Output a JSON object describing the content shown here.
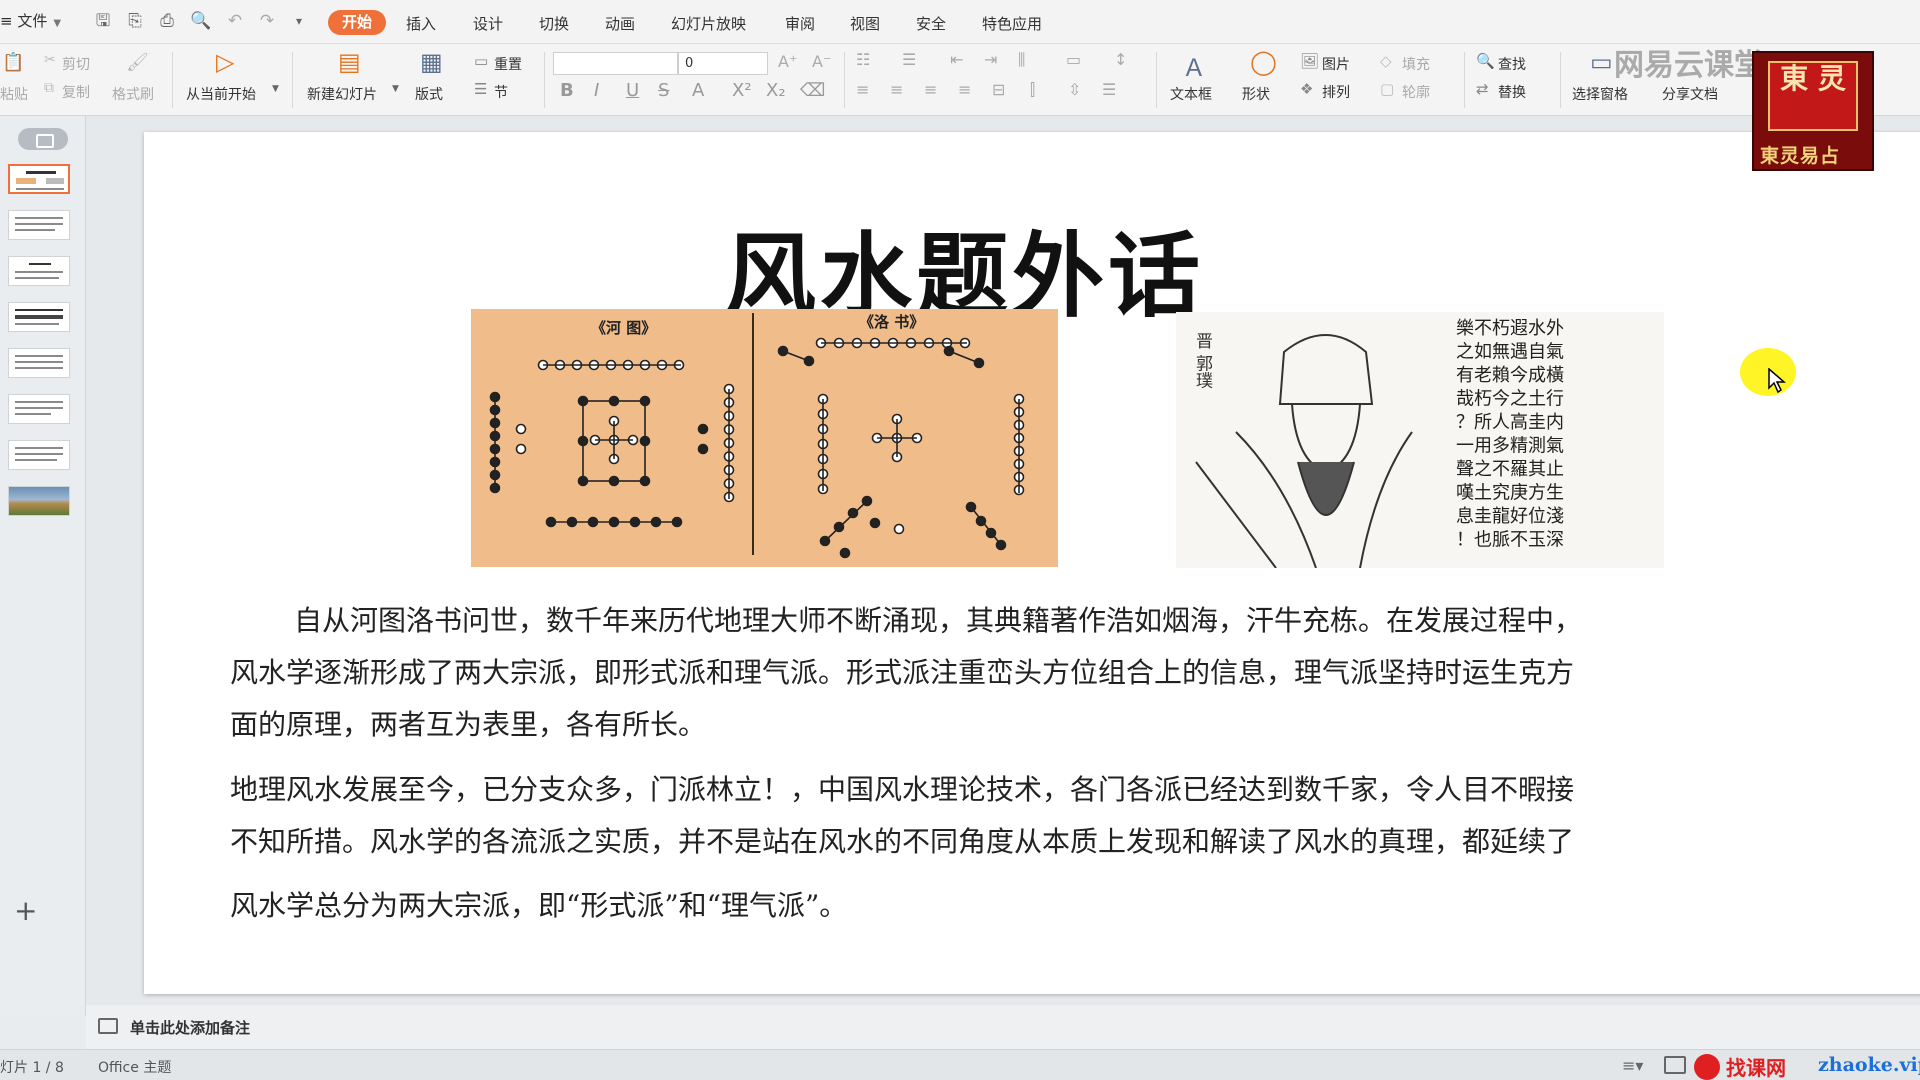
{
  "menubar": {
    "file_label": "文件",
    "tabs": [
      "开始",
      "插入",
      "设计",
      "切换",
      "动画",
      "幻灯片放映",
      "审阅",
      "视图",
      "安全",
      "特色应用"
    ],
    "active_tab": "开始",
    "accent_color": "#f0703a"
  },
  "ribbon": {
    "paste_label": "粘贴",
    "cut_label": "剪切",
    "copy_label": "复制",
    "format_painter_label": "格式刷",
    "play_from_current_label": "从当前开始",
    "new_slide_label": "新建幻灯片",
    "layout_label": "版式",
    "reset_label": "重置",
    "section_label": "节",
    "font_size_value": "0",
    "textbox_label": "文本框",
    "shape_label": "形状",
    "picture_label": "图片",
    "fill_label": "填充",
    "arrange_label": "排列",
    "outline_label": "轮廓",
    "find_label": "查找",
    "replace_label": "替换",
    "selection_pane_label": "选择窗格",
    "share_doc_label": "分享文档"
  },
  "watermark": {
    "cloud_text": "网易云课堂",
    "logo_chars": "東 灵",
    "logo_text": "東灵易占"
  },
  "slide": {
    "title": "风水题外话",
    "hetu_title": "《河 图》",
    "luoshu_title": "《洛 书》",
    "portrait_name": "晋 郭璞",
    "poem_lines": [
      "樂不朽遐水外",
      "之如無遇自氣",
      "有老賴今成橫",
      "哉朽今之土行",
      "？所人高圭内",
      "一用多精測氣",
      "聲之不羅其止",
      "嘆土究庚方生",
      "息圭龍好位淺",
      "！也脈不玉深"
    ],
    "paragraphs": [
      "自从河图洛书问世，数千年来历代地理大师不断涌现，其典籍著作浩如烟海，汗牛充栋。在发展过程中，",
      "风水学逐渐形成了两大宗派，即形式派和理气派。形式派注重峦头方位组合上的信息，理气派坚持时运生克方",
      "面的原理，两者互为表里，各有所长。",
      "地理风水发展至今，已分支众多，门派林立！，中国风水理论技术，各门各派已经达到数千家，令人目不暇接",
      "不知所措。风水学的各流派之实质，并不是站在风水的不同角度从本质上发现和解读了风水的真理，都延续了",
      "风水学总分为两大宗派，即“形式派”和“理气派”。"
    ]
  },
  "notes": {
    "placeholder": "单击此处添加备注"
  },
  "status": {
    "slide_indicator": "灯片 1 / 8",
    "theme": "Office 主题",
    "site_text": "找课网",
    "site_url": "zhaoke.vip"
  }
}
